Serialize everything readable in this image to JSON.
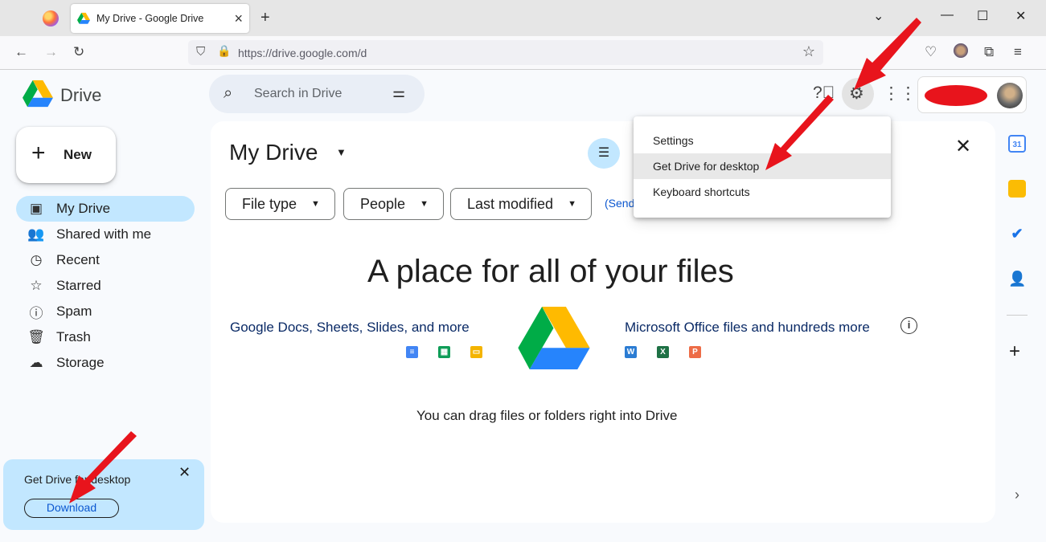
{
  "browser": {
    "tab_title": "My Drive - Google Drive",
    "url": "https://drive.google.com/d",
    "icons": [
      "firefox-logo",
      "back-arrow",
      "forward-arrow",
      "reload",
      "shield",
      "lock",
      "star",
      "pocket",
      "extensions",
      "menu"
    ]
  },
  "drive": {
    "logo_text": "Drive",
    "search_placeholder": "Search in Drive",
    "new_label": "New",
    "sidebar": [
      {
        "label": "My Drive",
        "icon": "my-drive-icon"
      },
      {
        "label": "Shared with me",
        "icon": "people-icon"
      },
      {
        "label": "Recent",
        "icon": "clock-icon"
      },
      {
        "label": "Starred",
        "icon": "star-icon"
      },
      {
        "label": "Spam",
        "icon": "spam-icon"
      },
      {
        "label": "Trash",
        "icon": "trash-icon"
      },
      {
        "label": "Storage",
        "icon": "cloud-icon"
      }
    ],
    "promo": {
      "text": "Get Drive for desktop",
      "button": "Download"
    },
    "main": {
      "title": "My Drive",
      "filters": [
        "File type",
        "People",
        "Last modified"
      ],
      "send_link": "(Send",
      "headline": "A place for all of your files",
      "left_sub": "Google Docs, Sheets, Slides, and more",
      "right_sub": "Microsoft Office files and hundreds more",
      "drag_text": "You can drag files or folders right into Drive",
      "office_letters": [
        "W",
        "X",
        "P"
      ]
    },
    "settings_menu": [
      "Settings",
      "Get Drive for desktop",
      "Keyboard shortcuts"
    ],
    "highlighted_menu_item": "Get Drive for desktop",
    "calendar_day": "31"
  },
  "colors": {
    "accent": "#c2e7ff",
    "annotation_arrow": "#e8141c",
    "blue_link": "#0b57d0"
  }
}
